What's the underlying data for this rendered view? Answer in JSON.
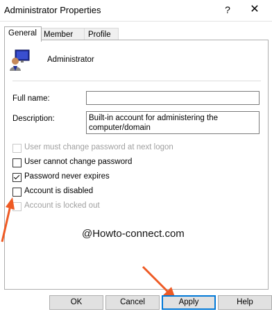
{
  "window": {
    "title": "Administrator Properties",
    "help_glyph": "?",
    "close_glyph": "✕"
  },
  "tabs": [
    {
      "label": "General",
      "active": true
    },
    {
      "label": "Member Of",
      "active": false
    },
    {
      "label": "Profile",
      "active": false
    }
  ],
  "account": {
    "name": "Administrator"
  },
  "form": {
    "full_name_label": "Full name:",
    "full_name_value": "",
    "description_label": "Description:",
    "description_value": "Built-in account for administering the computer/domain"
  },
  "options": [
    {
      "label": "User must change password at next logon",
      "checked": false,
      "disabled": true
    },
    {
      "label": "User cannot change password",
      "checked": false,
      "disabled": false
    },
    {
      "label": "Password never expires",
      "checked": true,
      "disabled": false
    },
    {
      "label": "Account is disabled",
      "checked": false,
      "disabled": false
    },
    {
      "label": "Account is locked out",
      "checked": false,
      "disabled": true
    }
  ],
  "watermark": "@Howto-connect.com",
  "buttons": {
    "ok": "OK",
    "cancel": "Cancel",
    "apply": "Apply",
    "help": "Help"
  },
  "colors": {
    "annotation_arrow": "#ee5a24",
    "focus_border": "#0078d7"
  }
}
